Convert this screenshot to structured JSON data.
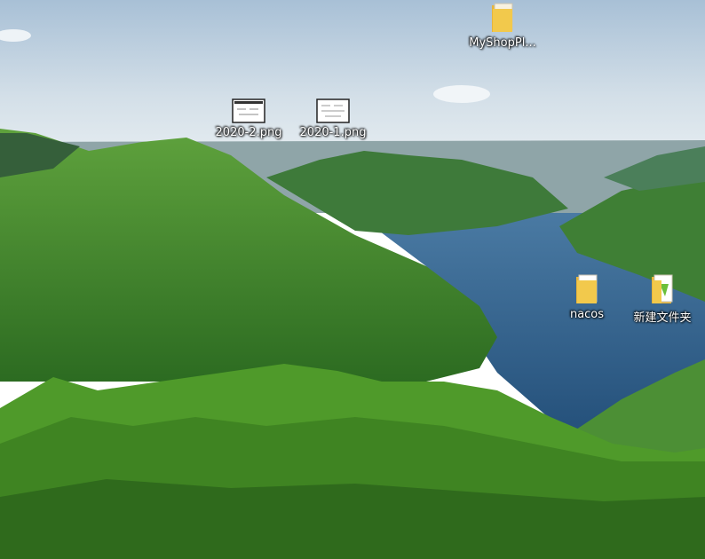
{
  "desktop": {
    "icons": [
      {
        "name": "MyShopPl...",
        "kind": "folder-icon"
      },
      {
        "name": "2020-2.png",
        "kind": "image-file-icon"
      },
      {
        "name": "2020-1.png",
        "kind": "image-file-icon"
      },
      {
        "name": "nacos",
        "kind": "folder-icon"
      },
      {
        "name": "新建文件夹",
        "kind": "folder-icon"
      }
    ]
  },
  "colors": {
    "sky": "#c9d9e6",
    "lake": "#2f5c86",
    "forest": "#3f8a2c"
  }
}
